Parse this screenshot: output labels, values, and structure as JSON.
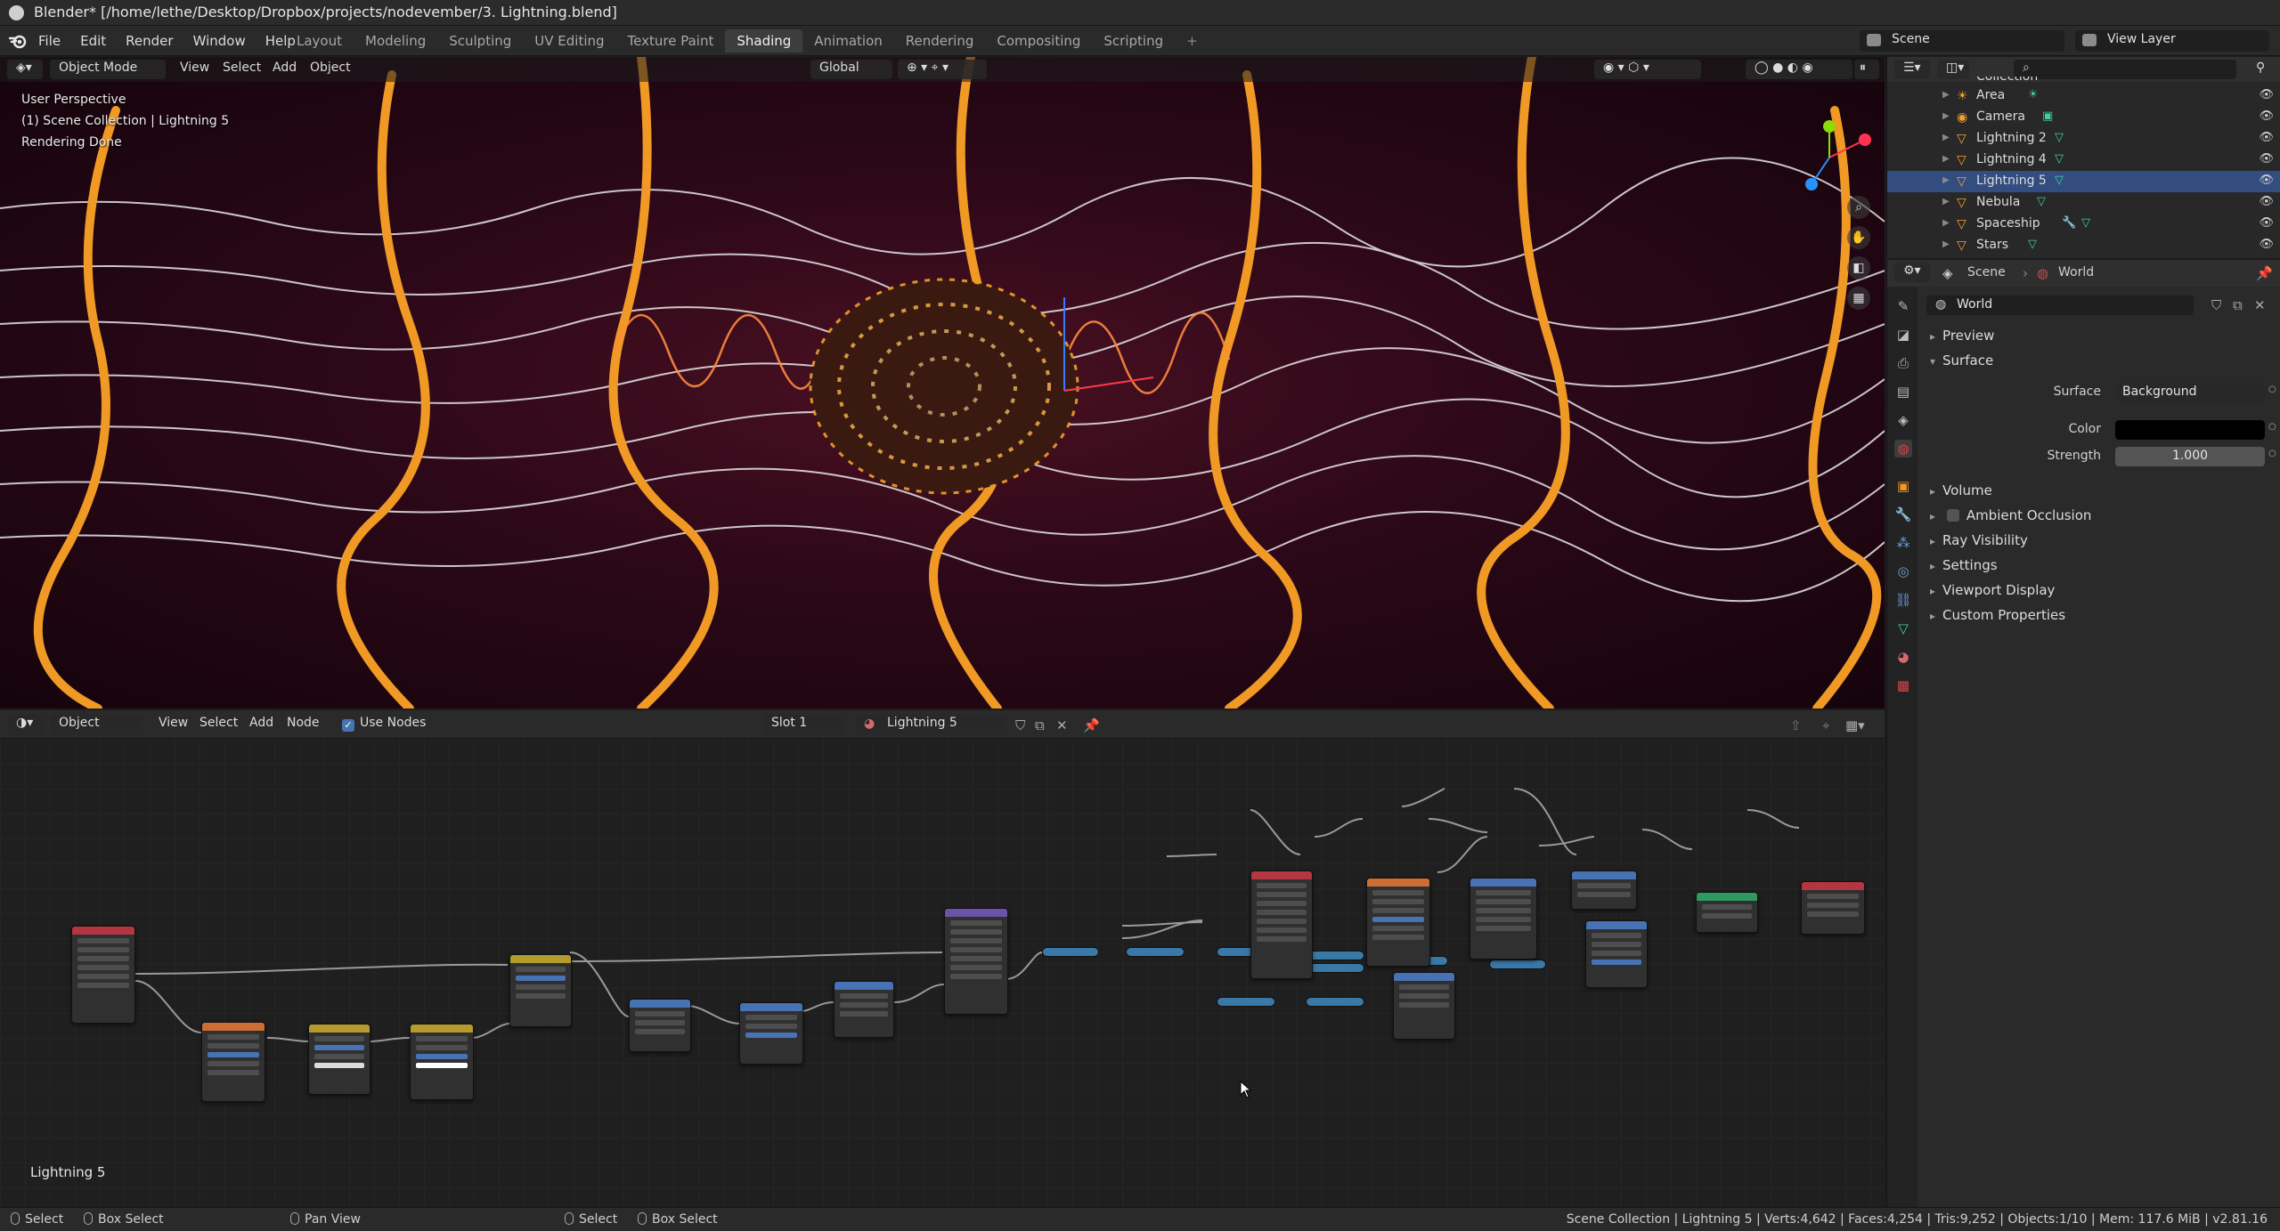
{
  "window": {
    "title": "Blender* [/home/lethe/Desktop/Dropbox/projects/nodevember/3. Lightning.blend]"
  },
  "menu": {
    "file": "File",
    "edit": "Edit",
    "render": "Render",
    "window": "Window",
    "help": "Help"
  },
  "workspaces": [
    "Layout",
    "Modeling",
    "Sculpting",
    "UV Editing",
    "Texture Paint",
    "Shading",
    "Animation",
    "Rendering",
    "Compositing",
    "Scripting"
  ],
  "active_workspace": "Shading",
  "scene": {
    "name": "Scene",
    "view_layer": "View Layer"
  },
  "viewport": {
    "mode": "Object Mode",
    "view": "View",
    "select": "Select",
    "add": "Add",
    "object": "Object",
    "orientation": "Global",
    "info": [
      "User Perspective",
      "(1) Scene Collection | Lightning 5",
      "Rendering Done"
    ]
  },
  "outliner": {
    "items": [
      {
        "name": "Collection",
        "selected": false
      },
      {
        "name": "Area",
        "selected": false
      },
      {
        "name": "Camera",
        "selected": false
      },
      {
        "name": "Lightning 2",
        "selected": false
      },
      {
        "name": "Lightning 4",
        "selected": false
      },
      {
        "name": "Lightning 5",
        "selected": true
      },
      {
        "name": "Nebula",
        "selected": false
      },
      {
        "name": "Spaceship",
        "selected": false
      },
      {
        "name": "Stars",
        "selected": false
      }
    ]
  },
  "properties": {
    "breadcrumb_scene": "Scene",
    "breadcrumb_world": "World",
    "world_name": "World",
    "sections": {
      "preview": "Preview",
      "surface": "Surface",
      "volume": "Volume",
      "ambient_occlusion": "Ambient Occlusion",
      "ray_visibility": "Ray Visibility",
      "settings": "Settings",
      "viewport_display": "Viewport Display",
      "custom_properties": "Custom Properties"
    },
    "surface_label": "Surface",
    "surface_value": "Background",
    "color_label": "Color",
    "color_value": "#000000",
    "strength_label": "Strength",
    "strength_value": "1.000"
  },
  "node_editor": {
    "type": "Object",
    "view": "View",
    "select": "Select",
    "add": "Add",
    "node": "Node",
    "use_nodes": "Use Nodes",
    "slot": "Slot 1",
    "material": "Lightning 5",
    "label": "Lightning 5"
  },
  "statusbar": {
    "select": "Select",
    "box_select": "Box Select",
    "pan_view": "Pan View",
    "select2": "Select",
    "box_select2": "Box Select",
    "stats": "Scene Collection | Lightning 5 | Verts:4,642 | Faces:4,254 | Tris:9,252 | Objects:1/10 | Mem: 117.6 MiB | v2.81.16"
  },
  "colors": {
    "accent_blue": "#4772b3",
    "selection": "#334d80",
    "lightning_orange": "#f09a25",
    "lightning_white": "#e8e8e8"
  }
}
